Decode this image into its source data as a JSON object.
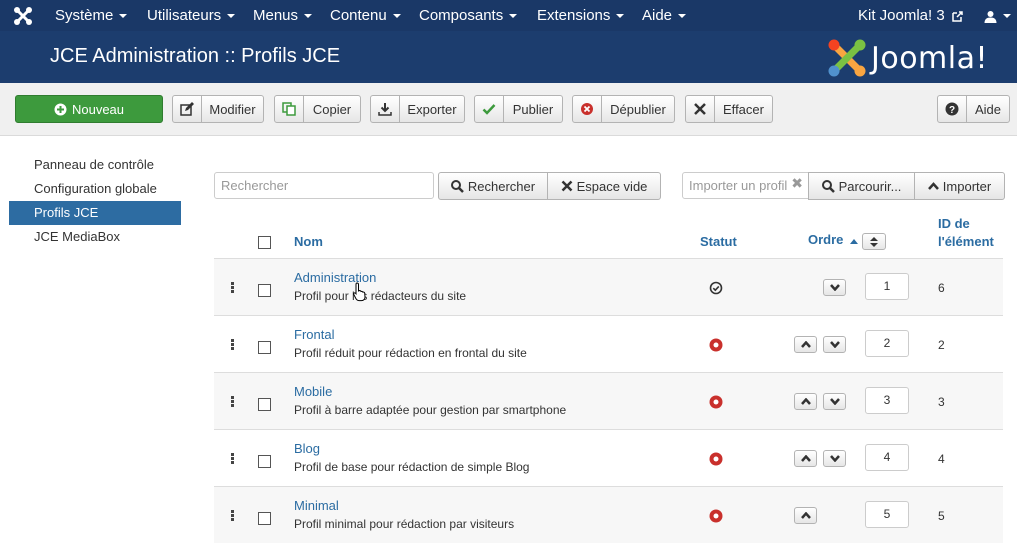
{
  "topnav": {
    "menus": [
      "Système",
      "Utilisateurs",
      "Menus",
      "Contenu",
      "Composants",
      "Extensions",
      "Aide"
    ],
    "site_link": "Kit Joomla! 3"
  },
  "header": {
    "title": "JCE Administration :: Profils JCE",
    "brand": "Joomla!"
  },
  "toolbar": {
    "new": "Nouveau",
    "edit": "Modifier",
    "copy": "Copier",
    "export": "Exporter",
    "publish": "Publier",
    "unpublish": "Dépublier",
    "delete": "Effacer",
    "help": "Aide"
  },
  "sidebar": {
    "items": [
      "Panneau de contrôle",
      "Configuration globale",
      "Profils JCE",
      "JCE MediaBox"
    ],
    "active_index": 2
  },
  "filters": {
    "search_placeholder": "Rechercher",
    "search_button": "Rechercher",
    "clear_button": "Espace vide",
    "import_placeholder": "Importer un profil",
    "browse_button": "Parcourir...",
    "import_button": "Importer"
  },
  "table": {
    "headers": {
      "name": "Nom",
      "status": "Statut",
      "order": "Ordre",
      "id_line1": "ID de",
      "id_line2": "l'élément"
    },
    "rows": [
      {
        "name": "Administration",
        "description": "Profil pour les rédacteurs du site",
        "status": "default",
        "order": "1",
        "id": "6",
        "up": false,
        "down": true
      },
      {
        "name": "Frontal",
        "description": "Profil réduit pour rédaction en frontal du site",
        "status": "unpublished",
        "order": "2",
        "id": "2",
        "up": true,
        "down": true
      },
      {
        "name": "Mobile",
        "description": "Profil à barre adaptée pour gestion par smartphone",
        "status": "unpublished",
        "order": "3",
        "id": "3",
        "up": true,
        "down": true
      },
      {
        "name": "Blog",
        "description": "Profil de base pour rédaction de simple Blog",
        "status": "unpublished",
        "order": "4",
        "id": "4",
        "up": true,
        "down": true
      },
      {
        "name": "Minimal",
        "description": "Profil minimal pour rédaction par visiteurs",
        "status": "unpublished",
        "order": "5",
        "id": "5",
        "up": true,
        "down": false
      }
    ]
  },
  "colors": {
    "topnav_bg": "#1a3867",
    "header_bg": "#1c3d6e",
    "link": "#2b6ca2",
    "new_button": "#3d9a3d",
    "unpublished_status": "#c9302c"
  }
}
